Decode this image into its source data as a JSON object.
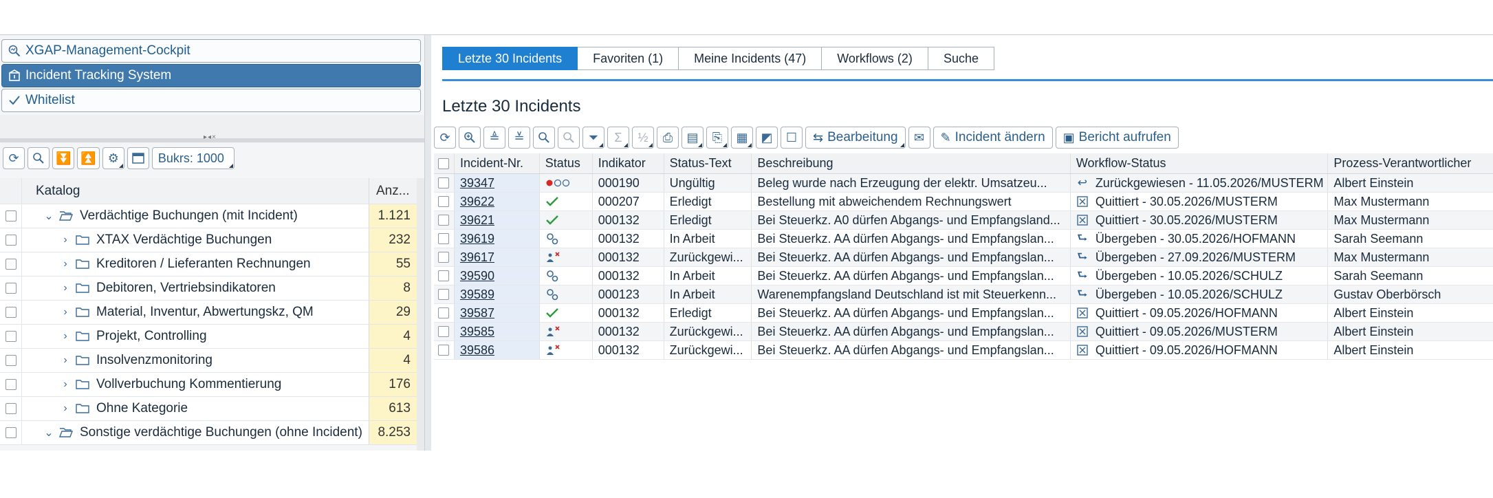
{
  "left": {
    "nav": [
      {
        "label": "XGAP-Management-Cockpit",
        "icon": "magnifier-chart-icon"
      },
      {
        "label": "Incident Tracking System",
        "icon": "incident-box-icon",
        "active": true
      },
      {
        "label": "Whitelist",
        "icon": "checkmark-icon"
      }
    ],
    "toolbar": {
      "bukrs_label": "Bukrs: 1000"
    },
    "tree": {
      "header": {
        "name": "Katalog",
        "count": "Anz..."
      },
      "rows": [
        {
          "label": "Verdächtige Buchungen (mit Incident)",
          "count": "1.121",
          "level": 1,
          "expanded": true
        },
        {
          "label": "XTAX Verdächtige Buchungen",
          "count": "232",
          "level": 2
        },
        {
          "label": "Kreditoren / Lieferanten Rechnungen",
          "count": "55",
          "level": 2
        },
        {
          "label": "Debitoren, Vertriebsindikatoren",
          "count": "8",
          "level": 2
        },
        {
          "label": "Material, Inventur, Abwertungskz, QM",
          "count": "29",
          "level": 2
        },
        {
          "label": "Projekt, Controlling",
          "count": "4",
          "level": 2
        },
        {
          "label": "Insolvenzmonitoring",
          "count": "4",
          "level": 2
        },
        {
          "label": "Vollverbuchung Kommentierung",
          "count": "176",
          "level": 2
        },
        {
          "label": "Ohne Kategorie",
          "count": "613",
          "level": 2
        },
        {
          "label": "Sonstige verdächtige Buchungen (ohne Incident)",
          "count": "8.253",
          "level": 1,
          "expanded": true
        }
      ]
    }
  },
  "right": {
    "tabs": [
      {
        "label": "Letzte 30 Incidents",
        "active": true
      },
      {
        "label": "Favoriten (1)"
      },
      {
        "label": "Meine Incidents (47)"
      },
      {
        "label": "Workflows (2)"
      },
      {
        "label": "Suche"
      }
    ],
    "title": "Letzte 30 Incidents",
    "toolbar": {
      "bearbeitung": "Bearbeitung",
      "incident_aendern": "Incident ändern",
      "bericht_aufrufen": "Bericht aufrufen"
    },
    "columns": [
      "Incident-Nr.",
      "Status",
      "Indikator",
      "Status-Text",
      "Beschreibung",
      "Workflow-Status",
      "Prozess-Verantwortlicher"
    ],
    "rows": [
      {
        "id": "39347",
        "status": "red-light",
        "indikator": "000190",
        "status_text": "Ungültig",
        "beschreibung": "Beleg wurde nach Erzeugung der elektr. Umsatzeu...",
        "wf_icon": "return-icon",
        "workflow": "Zurückgewiesen - 11.05.2026/MUSTERM",
        "verantwortlicher": "Albert Einstein"
      },
      {
        "id": "39622",
        "status": "check",
        "indikator": "000207",
        "status_text": "Erledigt",
        "beschreibung": "Bestellung mit abweichendem Rechnungswert",
        "wf_icon": "quit-box-icon",
        "workflow": "Quittiert - 30.05.2026/MUSTERM",
        "verantwortlicher": "Max Mustermann"
      },
      {
        "id": "39621",
        "status": "check",
        "indikator": "000132",
        "status_text": "Erledigt",
        "beschreibung": "Bei Steuerkz. A0 dürfen Abgangs- und Empfangsland...",
        "wf_icon": "quit-box-icon",
        "workflow": "Quittiert - 30.05.2026/MUSTERM",
        "verantwortlicher": "Max Mustermann"
      },
      {
        "id": "39619",
        "status": "gears",
        "indikator": "000132",
        "status_text": "In Arbeit",
        "beschreibung": "Bei Steuerkz. AA dürfen Abgangs- und Empfangslan...",
        "wf_icon": "forward-icon",
        "workflow": "Übergeben - 30.05.2026/HOFMANN",
        "verantwortlicher": "Sarah Seemann"
      },
      {
        "id": "39617",
        "status": "rejected",
        "indikator": "000132",
        "status_text": "Zurückgewi...",
        "beschreibung": "Bei Steuerkz. AA dürfen Abgangs- und Empfangslan...",
        "wf_icon": "forward-icon",
        "workflow": "Übergeben - 27.09.2026/MUSTERM",
        "verantwortlicher": "Max Mustermann"
      },
      {
        "id": "39590",
        "status": "gears",
        "indikator": "000132",
        "status_text": "In Arbeit",
        "beschreibung": "Bei Steuerkz. AA dürfen Abgangs- und Empfangslan...",
        "wf_icon": "forward-icon",
        "workflow": "Übergeben - 10.05.2026/SCHULZ",
        "verantwortlicher": "Sarah Seemann"
      },
      {
        "id": "39589",
        "status": "gears",
        "indikator": "000123",
        "status_text": "In Arbeit",
        "beschreibung": "Warenempfangsland Deutschland ist mit Steuerkenn...",
        "wf_icon": "forward-icon",
        "workflow": "Übergeben - 10.05.2026/SCHULZ",
        "verantwortlicher": "Gustav Oberbörsch"
      },
      {
        "id": "39587",
        "status": "check",
        "indikator": "000132",
        "status_text": "Erledigt",
        "beschreibung": "Bei Steuerkz. AA dürfen Abgangs- und Empfangslan...",
        "wf_icon": "quit-box-icon",
        "workflow": "Quittiert - 09.05.2026/HOFMANN",
        "verantwortlicher": "Albert Einstein"
      },
      {
        "id": "39585",
        "status": "rejected",
        "indikator": "000132",
        "status_text": "Zurückgewi...",
        "beschreibung": "Bei Steuerkz. AA dürfen Abgangs- und Empfangslan...",
        "wf_icon": "quit-box-icon",
        "workflow": "Quittiert - 09.05.2026/MUSTERM",
        "verantwortlicher": "Albert Einstein"
      },
      {
        "id": "39586",
        "status": "rejected",
        "indikator": "000132",
        "status_text": "Zurückgewi...",
        "beschreibung": "Bei Steuerkz. AA dürfen Abgangs- und Empfangslan...",
        "wf_icon": "quit-box-icon",
        "workflow": "Quittiert - 09.05.2026/HOFMANN",
        "verantwortlicher": "Albert Einstein"
      }
    ]
  },
  "colors": {
    "accent": "#1f7fd0",
    "nav_active": "#3f79ad",
    "count_bg": "#fdf5c8",
    "ok_green": "#2e9a3e",
    "red": "#d42a2a"
  }
}
